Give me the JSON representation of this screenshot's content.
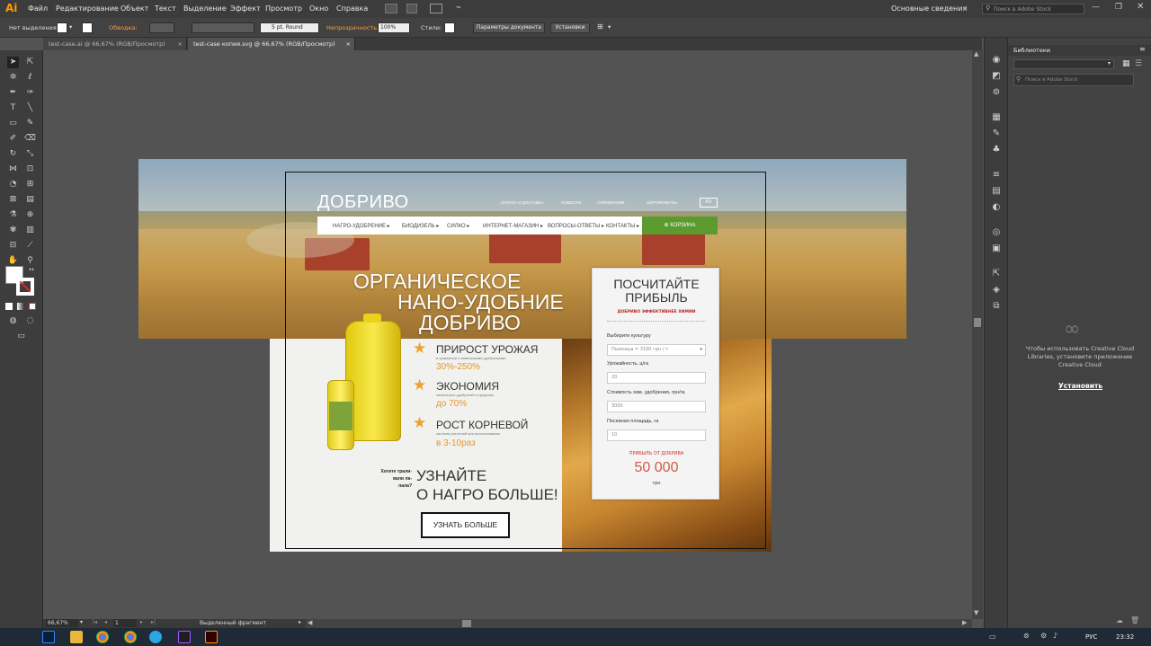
{
  "app": {
    "logo": "Ai",
    "menu": [
      "Файл",
      "Редактирование",
      "Объект",
      "Текст",
      "Выделение",
      "Эффект",
      "Просмотр",
      "Окно",
      "Справка"
    ],
    "workspace": "Основные сведения",
    "stock_search_placeholder": "Поиск в Adobe Stock"
  },
  "control_bar": {
    "selection": "Нет выделения",
    "stroke_label": "Обводка:",
    "brush": "5 pt. Round",
    "opacity_label": "Непрозрачность:",
    "opacity_value": "100%",
    "styles_label": "Стили:",
    "doc_setup": "Параметры документа",
    "prefs": "Установки"
  },
  "tabs": [
    {
      "label": "test-case.ai @ 66,67% (RGB/Просмотр)"
    },
    {
      "label": "test-case копия.svg @ 66,67% (RGB/Просмотр)"
    }
  ],
  "status": {
    "zoom": "66,67%",
    "artboard": "1",
    "selection_state": "Выделенный фрагмент"
  },
  "libraries": {
    "title": "Библиотеки",
    "search_placeholder": "Поиск в Adobe Stock",
    "message": "Чтобы использовать Creative Cloud Libraries, установите приложение Creative Cloud",
    "install": "Установить"
  },
  "taskbar": {
    "lang": "РУС",
    "time": "23:32"
  },
  "site": {
    "logo": "ДОБРИВО",
    "top_links": [
      "ОПЛАТА И ДОСТАВКА",
      "НОВОСТИ",
      "СПРАВОЧНИК",
      "СЕРТИФИКАТЫ"
    ],
    "lang": "RU",
    "nav": [
      "НАГРО-УДОБРЕНИЕ",
      "БИОДИЗЕЛЬ",
      "СИЛКО",
      "ИНТЕРНЕТ-МАГАЗИН",
      "ВОПРОСЫ-ОТВЕТЫ",
      "КОНТАКТЫ"
    ],
    "cart": "КОРЗИНА",
    "hero_line1": "ОРГАНИЧЕСКОЕ",
    "hero_line2": "НАНО-УДОБНИЕ",
    "hero_line3": "ДОБРИВО",
    "features": [
      {
        "title": "ПРИРОСТ УРОЖАЯ",
        "sub": "в сравнении с химическими удобрениями",
        "value": "30%-250%"
      },
      {
        "title": "ЭКОНОМИЯ",
        "sub": "химических удобрений и средства",
        "value": "до 70%"
      },
      {
        "title": "РОСТ КОРНЕВОЙ",
        "sub": "системы растений при использовании",
        "value": "в 3-10раз"
      }
    ],
    "side_note": "Хотите трали-вали ла-лала?",
    "cta_line1": "УЗНАЙТЕ",
    "cta_line2": "О НАГРО БОЛЬШЕ!",
    "cta_button": "УЗНАТЬ БОЛЬШЕ",
    "calc": {
      "title": "ПОСЧИТАЙТЕ ПРИБЫЛЬ",
      "subtitle": "ДОБРИВО ЭФФЕКТИВНЕЕ ХИМИИ",
      "crop_label": "Выберите культуру",
      "crop_value": "Пшеница = 3100 грн / т",
      "yield_label": "Урожайность, ц/га",
      "yield_value": "20",
      "cost_label": "Стоимость хим. удобрения, грн/га",
      "cost_value": "3000",
      "area_label": "Посевная площадь, га",
      "area_value": "10",
      "profit_label": "ПРИБЫЛЬ ОТ ДОБРИВА",
      "profit_value": "50 000",
      "currency": "грн"
    }
  }
}
